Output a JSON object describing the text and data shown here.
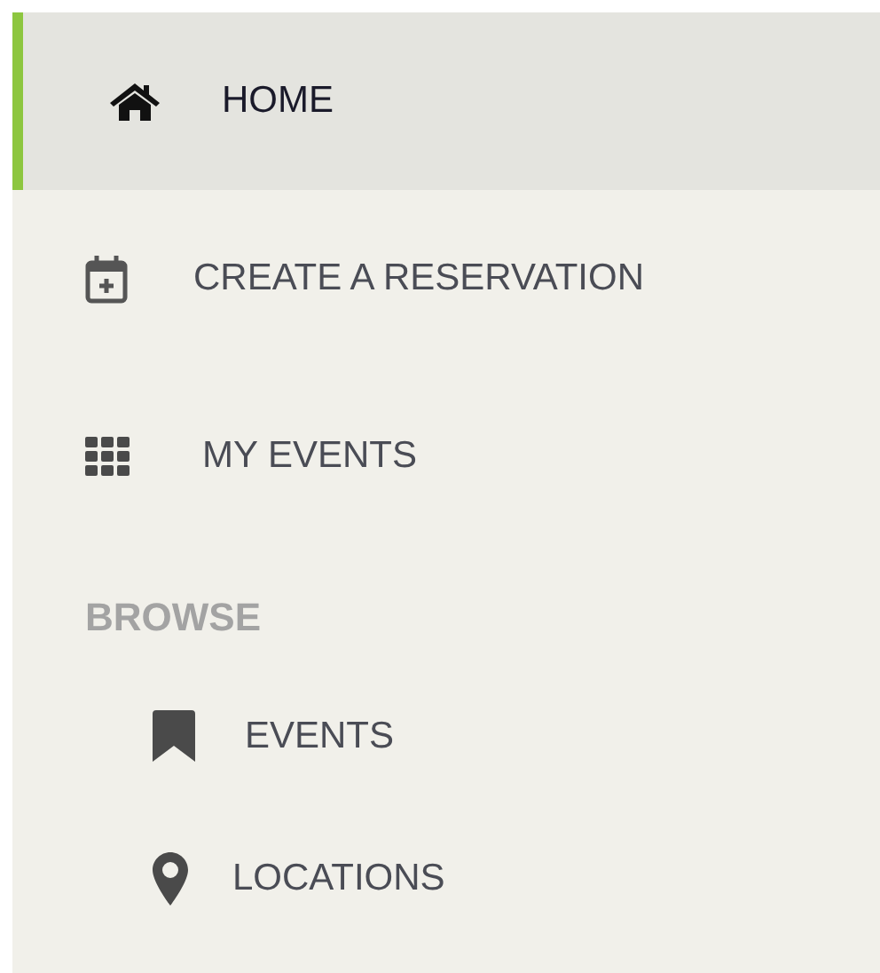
{
  "nav": {
    "items": [
      {
        "label": "HOME",
        "selected": true
      },
      {
        "label": "CREATE A RESERVATION",
        "selected": false
      },
      {
        "label": "MY EVENTS",
        "selected": false
      }
    ]
  },
  "browse": {
    "heading": "BROWSE",
    "items": [
      {
        "label": "EVENTS",
        "selected": false
      },
      {
        "label": "LOCATIONS",
        "selected": false
      }
    ]
  }
}
